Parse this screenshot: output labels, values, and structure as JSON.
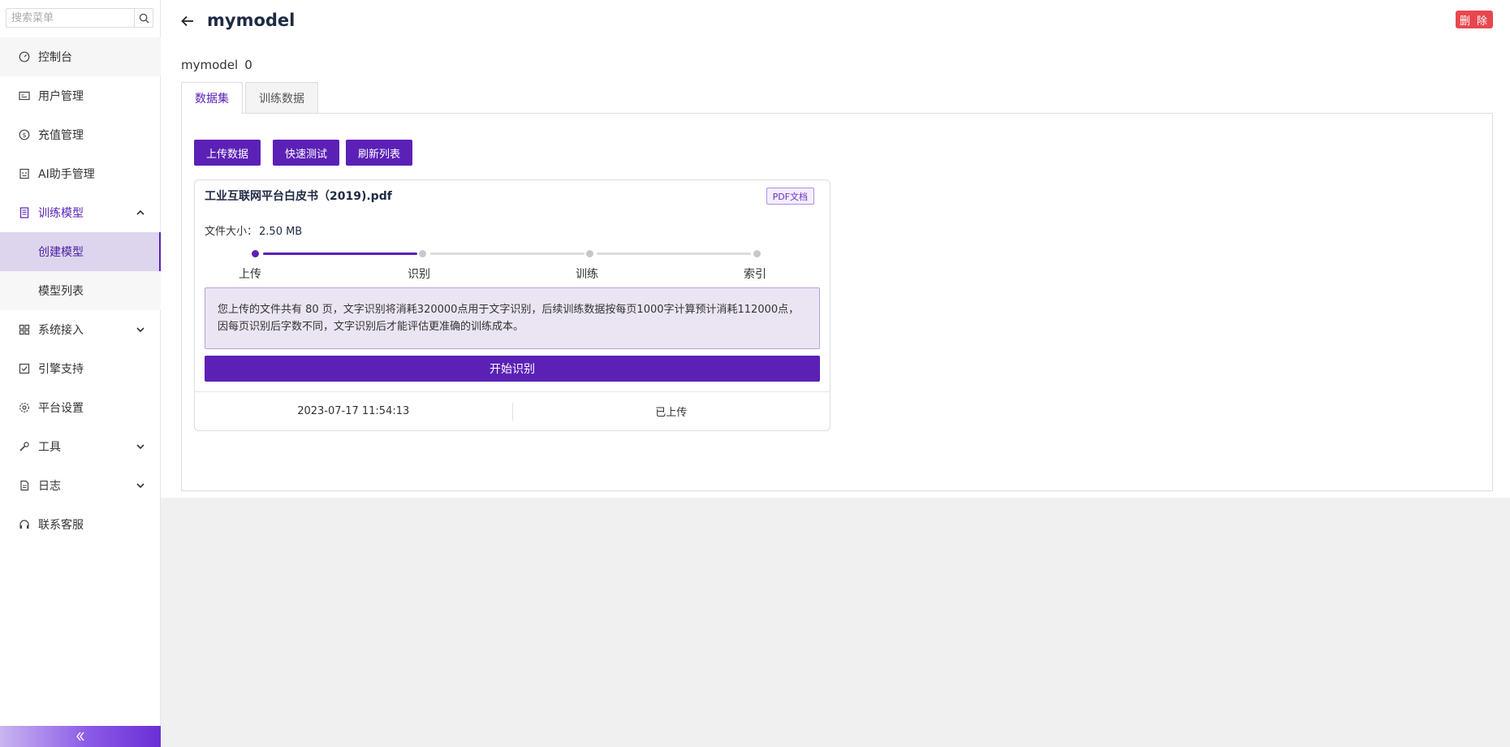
{
  "sidebar": {
    "search": {
      "placeholder": "搜索菜单"
    },
    "items": [
      {
        "label": "控制台",
        "icon": "dashboard-icon"
      },
      {
        "label": "用户管理",
        "icon": "id-card-icon"
      },
      {
        "label": "充值管理",
        "icon": "dollar-icon"
      },
      {
        "label": "AI助手管理",
        "icon": "robot-icon"
      },
      {
        "label": "训练模型",
        "icon": "book-icon",
        "expanded": true
      },
      {
        "label": "系统接入",
        "icon": "grid-icon"
      },
      {
        "label": "引擎支持",
        "icon": "checkbox-icon"
      },
      {
        "label": "平台设置",
        "icon": "gear-icon"
      },
      {
        "label": "工具",
        "icon": "wrench-icon"
      },
      {
        "label": "日志",
        "icon": "file-icon"
      },
      {
        "label": "联系客服",
        "icon": "headset-icon"
      }
    ],
    "submenu": [
      {
        "label": "创建模型",
        "selected": true
      },
      {
        "label": "模型列表"
      }
    ]
  },
  "header": {
    "title": "mymodel",
    "delete_label": "删 除"
  },
  "model_info": {
    "name": "mymodel",
    "count": "0"
  },
  "tabs": [
    {
      "label": "数据集",
      "active": true
    },
    {
      "label": "训练数据"
    }
  ],
  "toolbar": {
    "upload_label": "上传数据",
    "quick_test_label": "快速测试",
    "refresh_label": "刷新列表"
  },
  "file_card": {
    "title": "工业互联网平台白皮书（2019).pdf",
    "tag": "PDF文档",
    "size_label": "文件大小：",
    "size_value": "2.50 MB",
    "steps": [
      "上传",
      "识别",
      "训练",
      "索引"
    ],
    "current_step": 1,
    "notice": "您上传的文件共有 80 页，文字识别将消耗320000点用于文字识别，后续训练数据按每页1000字计算预计消耗112000点，因每页识别后字数不同，文字识别后才能评估更准确的训练成本。",
    "start_label": "开始识别",
    "timestamp": "2023-07-17 11:54:13",
    "status": "已上传"
  },
  "colors": {
    "primary": "#5b21b6",
    "danger": "#e8474f",
    "notice_bg": "#ebe5f3"
  }
}
